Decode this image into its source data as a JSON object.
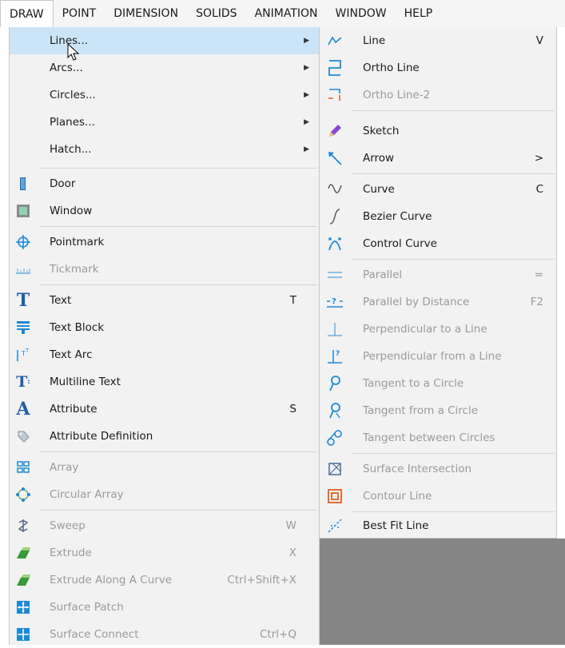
{
  "menubar": {
    "items": [
      "DRAW",
      "POINT",
      "DIMENSION",
      "SOLIDS",
      "ANIMATION",
      "WINDOW",
      "HELP"
    ]
  },
  "draw_menu": {
    "items": [
      {
        "label": "Lines...",
        "submenu": true,
        "icon": "none",
        "highlighted": true
      },
      {
        "label": "Arcs...",
        "submenu": true,
        "icon": "none"
      },
      {
        "label": "Circles...",
        "submenu": true,
        "icon": "none"
      },
      {
        "label": "Planes...",
        "submenu": true,
        "icon": "none"
      },
      {
        "label": "Hatch...",
        "submenu": true,
        "icon": "none"
      },
      {
        "label": "Door",
        "icon": "door-icon"
      },
      {
        "label": "Window",
        "icon": "window-icon"
      },
      {
        "label": "Pointmark",
        "icon": "pointmark-icon"
      },
      {
        "label": "Tickmark",
        "icon": "tickmark-icon",
        "disabled": true
      },
      {
        "label": "Text",
        "shortcut": "T",
        "icon": "text-icon"
      },
      {
        "label": "Text Block",
        "icon": "text-block-icon"
      },
      {
        "label": "Text Arc",
        "icon": "text-arc-icon"
      },
      {
        "label": "Multiline Text",
        "icon": "multiline-text-icon"
      },
      {
        "label": "Attribute",
        "shortcut": "S",
        "icon": "attribute-icon"
      },
      {
        "label": "Attribute Definition",
        "icon": "attribute-definition-icon"
      },
      {
        "label": "Array",
        "icon": "array-icon",
        "disabled": true
      },
      {
        "label": "Circular Array",
        "icon": "circular-array-icon",
        "disabled": true
      },
      {
        "label": "Sweep",
        "shortcut": "W",
        "icon": "sweep-icon",
        "disabled": true
      },
      {
        "label": "Extrude",
        "shortcut": "X",
        "icon": "extrude-icon",
        "disabled": true
      },
      {
        "label": "Extrude Along A Curve",
        "shortcut": "Ctrl+Shift+X",
        "icon": "extrude-curve-icon",
        "disabled": true
      },
      {
        "label": "Surface Patch",
        "icon": "surface-patch-icon",
        "disabled": true
      },
      {
        "label": "Surface Connect",
        "shortcut": "Ctrl+Q",
        "icon": "surface-connect-icon",
        "disabled": true
      }
    ]
  },
  "lines_submenu": {
    "items": [
      {
        "label": "Line",
        "shortcut": "V",
        "icon": "line-icon"
      },
      {
        "label": "Ortho Line",
        "icon": "ortho-line-icon"
      },
      {
        "label": "Ortho Line-2",
        "icon": "ortho-line-2-icon",
        "disabled": true
      },
      {
        "label": "Sketch",
        "icon": "pencil-icon"
      },
      {
        "label": "Arrow",
        "shortcut": ">",
        "icon": "arrow-icon"
      },
      {
        "label": "Curve",
        "shortcut": "C",
        "icon": "curve-icon"
      },
      {
        "label": "Bezier Curve",
        "icon": "bezier-curve-icon"
      },
      {
        "label": "Control Curve",
        "icon": "control-curve-icon"
      },
      {
        "label": "Parallel",
        "shortcut": "=",
        "icon": "parallel-icon",
        "disabled": true
      },
      {
        "label": "Parallel by Distance",
        "shortcut": "F2",
        "icon": "parallel-distance-icon",
        "disabled": true
      },
      {
        "label": "Perpendicular to a Line",
        "icon": "perpendicular-to-icon",
        "disabled": true
      },
      {
        "label": "Perpendicular from a Line",
        "icon": "perpendicular-from-icon",
        "disabled": true
      },
      {
        "label": "Tangent to a Circle",
        "icon": "tangent-to-circle-icon",
        "disabled": true
      },
      {
        "label": "Tangent from a Circle",
        "icon": "tangent-from-circle-icon",
        "disabled": true
      },
      {
        "label": "Tangent between Circles",
        "icon": "tangent-between-circles-icon",
        "disabled": true
      },
      {
        "label": "Surface Intersection",
        "icon": "surface-intersection-icon",
        "disabled": true
      },
      {
        "label": "Contour Line",
        "icon": "contour-line-icon",
        "disabled": true
      },
      {
        "label": "Best Fit Line",
        "icon": "best-fit-line-icon"
      }
    ]
  },
  "colors": {
    "highlight": "#cce4f7",
    "accent_blue": "#1a8ad4",
    "disabled_text": "#9a9a9a",
    "desktop_grey": "#858585"
  }
}
